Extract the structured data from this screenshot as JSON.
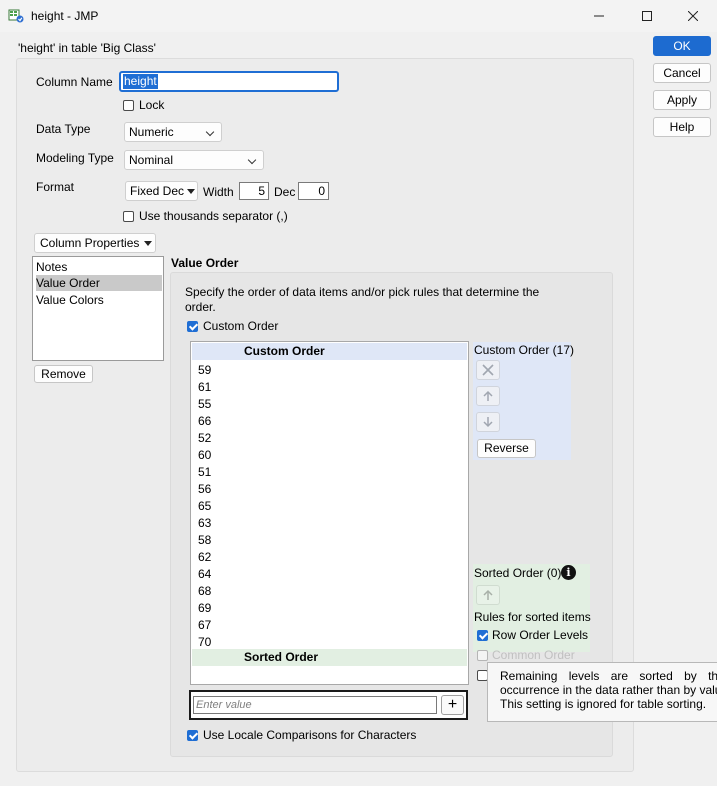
{
  "window": {
    "title": "height - JMP"
  },
  "subtitle": "'height' in table 'Big Class'",
  "buttons": {
    "ok": "OK",
    "cancel": "Cancel",
    "apply": "Apply",
    "help": "Help",
    "remove": "Remove",
    "reverse": "Reverse"
  },
  "column": {
    "name_label": "Column Name",
    "name_value": "height",
    "lock_label": "Lock",
    "data_type_label": "Data Type",
    "data_type_value": "Numeric",
    "modeling_type_label": "Modeling Type",
    "modeling_type_value": "Nominal",
    "format_label": "Format",
    "format_value": "Fixed Dec",
    "width_label": "Width",
    "width_value": "5",
    "dec_label": "Dec",
    "dec_value": "0",
    "thousands_label": "Use thousands separator (,)"
  },
  "properties": {
    "dropdown_label": "Column Properties",
    "items": [
      "Notes",
      "Value Order",
      "Value Colors"
    ],
    "selected": "Value Order"
  },
  "value_order": {
    "heading": "Value Order",
    "description": "Specify the order of data items and/or pick rules that determine the order.",
    "custom_order_checkbox": "Custom Order",
    "custom_order_header": "Custom Order",
    "custom_order_count": "Custom Order (17)",
    "custom_items": [
      "59",
      "61",
      "55",
      "66",
      "52",
      "60",
      "51",
      "56",
      "65",
      "63",
      "58",
      "62",
      "64",
      "68",
      "69",
      "67",
      "70"
    ],
    "sorted_order_header": "Sorted Order",
    "sorted_order_count": "Sorted Order (0)",
    "rules_label": "Rules for sorted items",
    "row_order_levels": "Row Order Levels",
    "common_order": "Common Order",
    "enter_placeholder": "Enter value",
    "plus": "+",
    "locale_label": "Use Locale Comparisons for Characters"
  },
  "tooltip": {
    "line1": "Remaining levels are sorted by th",
    "line2": "occurrence in the data rather than by valu",
    "line3": "This setting is ignored for table sorting."
  },
  "colors": {
    "accent": "#1f6ed4",
    "custom_panel": "#dfe7f7",
    "sorted_panel": "#e2efe2"
  }
}
